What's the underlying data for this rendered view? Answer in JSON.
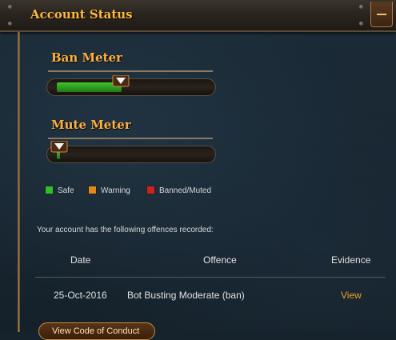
{
  "header": {
    "title": "Account Status"
  },
  "ban_meter": {
    "title": "Ban Meter",
    "level": 0.42,
    "fill_color": "#3fc22e"
  },
  "mute_meter": {
    "title": "Mute Meter",
    "level": 0.02,
    "fill_color": "#3fc22e"
  },
  "legend": [
    {
      "label": "Safe",
      "color": "#2fbf2a"
    },
    {
      "label": "Warning",
      "color": "#e08a1e"
    },
    {
      "label": "Banned/Muted",
      "color": "#cc2222"
    }
  ],
  "offences": {
    "intro": "Your account has the following offences recorded:",
    "columns": [
      "Date",
      "Offence",
      "Evidence"
    ],
    "rows": [
      {
        "date": "25-Oct-2016",
        "offence": "Bot Busting Moderate (ban)",
        "evidence": "View"
      }
    ]
  },
  "footer": {
    "code_of_conduct_label": "View Code of Conduct"
  },
  "colors": {
    "accent": "#ffb83b",
    "link": "#f0a020",
    "background": "#182631"
  }
}
